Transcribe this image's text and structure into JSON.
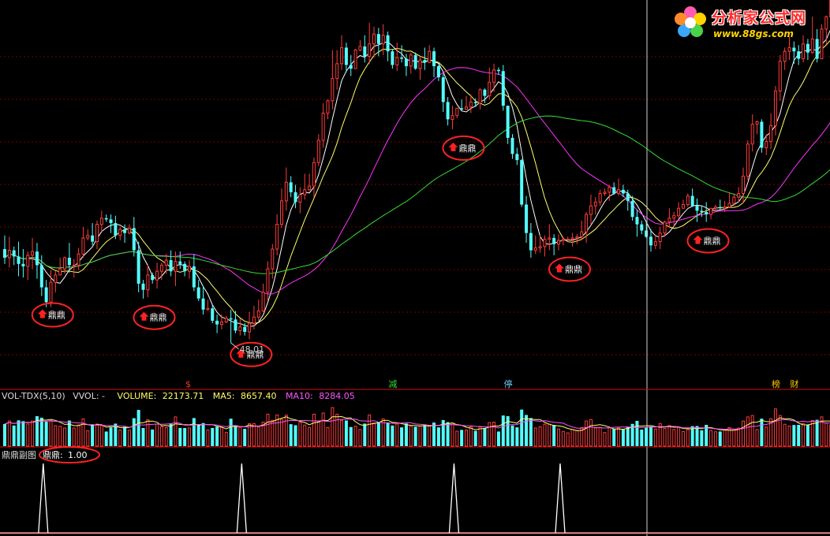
{
  "logo": {
    "title": "分析家公式网",
    "url": "www.88gs.com"
  },
  "colors": {
    "background": "#000000",
    "up": "#ff3b3b",
    "down": "#54ffff",
    "ma_short": "#ffffff",
    "ma_mid": "#ffff66",
    "ma_long": "#ff33ff",
    "ma_longer": "#33dd33",
    "panel_border": "#d01010",
    "highlight_oval": "#ff2222"
  },
  "chart_data": [
    {
      "type": "candlestick",
      "grid": "horizontal dashed",
      "price_range": [
        44.5,
        75.5
      ],
      "low_marker": {
        "label": "48.01",
        "value": 48.01,
        "index": 49
      },
      "event_labels": [
        {
          "index": 40,
          "text": "$"
        },
        {
          "index": 84,
          "text": "减"
        },
        {
          "index": 109,
          "text": "停"
        },
        {
          "index": 167,
          "text": "榜"
        },
        {
          "index": 171,
          "text": "财"
        }
      ],
      "signal_text": "鼎鼎",
      "signals": [
        8,
        30,
        51,
        97,
        120,
        150
      ],
      "candles_o_c_h_l": [
        [
          55.6,
          54.9,
          56.7,
          54.4
        ],
        [
          54.9,
          55.5,
          56.6,
          54.1
        ],
        [
          55.5,
          55.0,
          55.8,
          54.3
        ],
        [
          55.0,
          54.4,
          56.2,
          53.4
        ],
        [
          54.4,
          54.2,
          55.6,
          53.3
        ],
        [
          54.2,
          55.1,
          55.4,
          53.1
        ],
        [
          55.1,
          55.4,
          56.5,
          54.0
        ],
        [
          55.4,
          54.3,
          56.1,
          53.2
        ],
        [
          54.3,
          52.5,
          55.1,
          51.8
        ],
        [
          52.5,
          51.3,
          53.1,
          50.9
        ],
        [
          51.3,
          52.9,
          53.9,
          50.9
        ],
        [
          52.9,
          53.5,
          53.8,
          52.1
        ],
        [
          53.5,
          54.0,
          54.9,
          53.5
        ],
        [
          54.0,
          54.9,
          55.0,
          53.6
        ],
        [
          54.9,
          54.3,
          56.1,
          53.7
        ],
        [
          54.3,
          54.3,
          54.8,
          53.3
        ],
        [
          54.3,
          55.2,
          55.7,
          53.9
        ],
        [
          55.2,
          56.5,
          57.4,
          54.9
        ],
        [
          56.5,
          56.7,
          57.2,
          56.3
        ],
        [
          56.7,
          56.2,
          57.7,
          55.9
        ],
        [
          56.2,
          57.6,
          57.9,
          55.6
        ],
        [
          57.6,
          58.1,
          58.7,
          57.0
        ],
        [
          58.1,
          58.0,
          58.4,
          57.8
        ],
        [
          58.0,
          57.7,
          58.4,
          56.9
        ],
        [
          57.7,
          56.7,
          58.3,
          56.4
        ],
        [
          56.7,
          57.2,
          57.4,
          56.3
        ],
        [
          57.2,
          56.9,
          57.6,
          56.1
        ],
        [
          56.9,
          57.3,
          57.6,
          56.8
        ],
        [
          57.3,
          55.5,
          58.2,
          55.0
        ],
        [
          55.5,
          52.8,
          56.2,
          52.1
        ],
        [
          52.8,
          52.3,
          53.1,
          51.6
        ],
        [
          52.3,
          53.5,
          54.4,
          51.7
        ],
        [
          53.5,
          53.1,
          53.7,
          52.8
        ],
        [
          53.1,
          53.8,
          54.5,
          52.4
        ],
        [
          53.8,
          54.3,
          54.5,
          53.1
        ],
        [
          54.3,
          54.7,
          55.2,
          53.6
        ],
        [
          54.7,
          53.8,
          55.5,
          53.4
        ],
        [
          53.8,
          54.6,
          55.4,
          52.6
        ],
        [
          54.6,
          54.4,
          55.4,
          54.0
        ],
        [
          54.4,
          53.8,
          54.6,
          53.4
        ],
        [
          53.8,
          54.2,
          54.7,
          53.2
        ],
        [
          54.2,
          52.5,
          55.2,
          52.2
        ],
        [
          52.5,
          51.6,
          53.1,
          51.4
        ],
        [
          51.6,
          50.7,
          52.6,
          50.3
        ],
        [
          50.7,
          50.8,
          51.5,
          50.6
        ],
        [
          50.8,
          49.8,
          51.1,
          49.6
        ],
        [
          49.8,
          49.5,
          50.3,
          48.8
        ],
        [
          49.5,
          49.7,
          50.3,
          49.1
        ],
        [
          49.7,
          50.0,
          50.2,
          49.6
        ],
        [
          50.0,
          49.9,
          50.7,
          48.0
        ],
        [
          49.9,
          49.0,
          50.6,
          48.8
        ],
        [
          49.0,
          49.3,
          50.0,
          48.6
        ],
        [
          49.3,
          48.9,
          49.6,
          48.6
        ],
        [
          48.9,
          49.6,
          50.5,
          48.3
        ],
        [
          49.6,
          50.1,
          51.0,
          49.1
        ],
        [
          50.1,
          50.6,
          51.5,
          49.8
        ],
        [
          50.6,
          52.1,
          52.8,
          50.5
        ],
        [
          52.1,
          54.0,
          54.6,
          51.4
        ],
        [
          54.0,
          55.6,
          56.0,
          53.2
        ],
        [
          55.6,
          57.6,
          58.4,
          55.1
        ],
        [
          57.6,
          59.5,
          60.5,
          57.3
        ],
        [
          59.5,
          61.0,
          62.2,
          58.7
        ],
        [
          61.0,
          60.2,
          61.5,
          59.8
        ],
        [
          60.2,
          59.4,
          60.8,
          58.9
        ],
        [
          59.4,
          60.0,
          60.6,
          58.5
        ],
        [
          60.0,
          60.4,
          61.7,
          59.6
        ],
        [
          60.4,
          60.7,
          61.7,
          60.3
        ],
        [
          60.7,
          62.6,
          63.0,
          59.8
        ],
        [
          62.6,
          64.4,
          64.9,
          62.3
        ],
        [
          64.4,
          66.6,
          67.4,
          63.8
        ],
        [
          66.6,
          67.6,
          67.7,
          66.1
        ],
        [
          67.6,
          69.4,
          71.7,
          66.9
        ],
        [
          69.4,
          70.6,
          71.7,
          68.5
        ],
        [
          70.6,
          71.9,
          72.9,
          70.1
        ],
        [
          71.9,
          70.5,
          72.3,
          69.9
        ],
        [
          70.5,
          70.2,
          71.3,
          69.6
        ],
        [
          70.2,
          71.7,
          71.8,
          70.2
        ],
        [
          71.7,
          72.0,
          72.5,
          71.6
        ],
        [
          72.0,
          71.2,
          72.9,
          70.7
        ],
        [
          71.2,
          72.2,
          73.9,
          70.6
        ],
        [
          72.2,
          73.0,
          73.6,
          71.1
        ],
        [
          73.0,
          72.2,
          73.5,
          71.2
        ],
        [
          72.2,
          72.9,
          73.8,
          71.3
        ],
        [
          72.9,
          71.6,
          73.2,
          70.8
        ],
        [
          71.6,
          70.5,
          71.8,
          70.2
        ],
        [
          70.5,
          71.1,
          72.3,
          70.0
        ],
        [
          71.1,
          71.0,
          72.1,
          70.7
        ],
        [
          71.0,
          70.4,
          71.4,
          69.6
        ],
        [
          70.4,
          71.3,
          71.5,
          69.8
        ],
        [
          71.3,
          70.2,
          71.5,
          70.1
        ],
        [
          70.2,
          70.9,
          71.2,
          69.3
        ],
        [
          70.9,
          70.7,
          71.9,
          70.1
        ],
        [
          70.7,
          71.6,
          72.1,
          70.7
        ],
        [
          71.6,
          70.4,
          71.9,
          69.5
        ],
        [
          70.4,
          69.5,
          70.5,
          69.2
        ],
        [
          69.5,
          67.5,
          69.8,
          66.7
        ],
        [
          67.5,
          66.1,
          67.9,
          65.6
        ],
        [
          66.1,
          66.4,
          67.2,
          65.3
        ],
        [
          66.4,
          67.0,
          67.0,
          66.2
        ],
        [
          67.0,
          66.9,
          67.7,
          66.8
        ],
        [
          66.9,
          67.1,
          68.0,
          66.9
        ],
        [
          67.1,
          67.5,
          68.1,
          66.6
        ],
        [
          67.5,
          67.4,
          67.8,
          67.1
        ],
        [
          67.4,
          68.5,
          68.6,
          66.9
        ],
        [
          68.5,
          68.0,
          68.6,
          67.4
        ],
        [
          68.0,
          69.1,
          70.3,
          67.7
        ],
        [
          69.1,
          70.1,
          70.6,
          68.3
        ],
        [
          70.1,
          70.0,
          70.3,
          69.7
        ],
        [
          70.0,
          67.2,
          70.5,
          66.8
        ],
        [
          67.2,
          64.6,
          67.2,
          64.1
        ],
        [
          64.6,
          63.3,
          64.9,
          62.9
        ],
        [
          63.3,
          62.8,
          63.8,
          62.4
        ],
        [
          62.8,
          59.2,
          62.9,
          59.0
        ],
        [
          59.2,
          56.9,
          59.9,
          56.1
        ],
        [
          56.9,
          55.5,
          57.7,
          54.9
        ],
        [
          55.5,
          55.7,
          56.7,
          55.2
        ],
        [
          55.7,
          55.8,
          56.8,
          55.3
        ],
        [
          55.8,
          56.4,
          56.7,
          55.0
        ],
        [
          56.4,
          56.5,
          57.6,
          55.5
        ],
        [
          56.5,
          56.0,
          56.8,
          55.1
        ],
        [
          56.0,
          56.3,
          56.8,
          55.5
        ],
        [
          56.3,
          56.4,
          56.6,
          55.9
        ],
        [
          56.4,
          56.4,
          56.6,
          56.2
        ],
        [
          56.4,
          56.5,
          56.9,
          55.8
        ],
        [
          56.5,
          56.6,
          56.8,
          56.0
        ],
        [
          56.6,
          57.0,
          57.9,
          56.3
        ],
        [
          57.0,
          58.4,
          58.6,
          56.1
        ],
        [
          58.4,
          59.1,
          60.0,
          57.6
        ],
        [
          59.1,
          59.4,
          59.8,
          58.4
        ],
        [
          59.4,
          60.1,
          60.4,
          59.1
        ],
        [
          60.1,
          60.2,
          60.5,
          59.9
        ],
        [
          60.2,
          60.6,
          60.8,
          59.5
        ],
        [
          60.6,
          60.1,
          61.0,
          60.0
        ],
        [
          60.1,
          60.4,
          61.3,
          59.9
        ],
        [
          60.4,
          60.1,
          60.8,
          59.8
        ],
        [
          60.1,
          59.5,
          60.4,
          58.7
        ],
        [
          59.5,
          58.2,
          59.9,
          57.9
        ],
        [
          58.2,
          57.6,
          58.8,
          56.6
        ],
        [
          57.6,
          57.1,
          57.9,
          56.8
        ],
        [
          57.1,
          56.6,
          57.8,
          56.5
        ],
        [
          56.6,
          55.9,
          57.2,
          55.4
        ],
        [
          55.9,
          56.2,
          56.7,
          55.6
        ],
        [
          56.2,
          56.9,
          57.4,
          55.6
        ],
        [
          56.9,
          57.8,
          57.9,
          56.6
        ],
        [
          57.8,
          58.1,
          58.9,
          57.3
        ],
        [
          58.1,
          58.3,
          58.6,
          57.4
        ],
        [
          58.3,
          58.9,
          59.4,
          58.0
        ],
        [
          58.9,
          59.2,
          59.6,
          59.0
        ],
        [
          59.2,
          59.9,
          60.1,
          59.0
        ],
        [
          59.9,
          59.1,
          60.5,
          59.0
        ],
        [
          59.1,
          58.7,
          59.7,
          57.8
        ],
        [
          58.7,
          58.6,
          59.1,
          58.2
        ],
        [
          58.6,
          58.4,
          59.4,
          57.8
        ],
        [
          58.4,
          58.9,
          58.9,
          58.0
        ],
        [
          58.9,
          59.0,
          59.2,
          58.6
        ],
        [
          59.0,
          58.9,
          59.6,
          58.8
        ],
        [
          58.9,
          59.0,
          59.5,
          58.6
        ],
        [
          59.0,
          59.3,
          60.2,
          59.0
        ],
        [
          59.3,
          59.8,
          60.1,
          59.1
        ],
        [
          59.8,
          60.1,
          60.6,
          59.4
        ],
        [
          60.1,
          61.5,
          62.2,
          59.3
        ],
        [
          61.5,
          64.1,
          64.4,
          61.2
        ],
        [
          64.1,
          65.7,
          66.5,
          63.5
        ],
        [
          65.7,
          65.9,
          66.0,
          64.9
        ],
        [
          65.9,
          63.8,
          66.1,
          63.4
        ],
        [
          63.8,
          64.3,
          64.9,
          63.2
        ],
        [
          64.3,
          65.6,
          66.6,
          63.7
        ],
        [
          65.6,
          68.4,
          68.8,
          64.8
        ],
        [
          68.4,
          70.8,
          71.3,
          67.6
        ],
        [
          70.8,
          71.6,
          71.9,
          70.1
        ],
        [
          71.6,
          71.9,
          72.8,
          70.9
        ],
        [
          71.9,
          71.6,
          72.4,
          70.6
        ],
        [
          71.6,
          71.0,
          72.1,
          70.5
        ],
        [
          71.0,
          72.2,
          72.9,
          70.7
        ],
        [
          72.2,
          71.5,
          72.6,
          70.9
        ],
        [
          71.5,
          72.6,
          74.4,
          71.4
        ],
        [
          72.6,
          71.0,
          73.4,
          70.7
        ],
        [
          71.0,
          73.4,
          73.8,
          71.0
        ],
        [
          73.4,
          74.4,
          74.5,
          72.2
        ],
        [
          74.4,
          75.8,
          76.0,
          74.3
        ],
        [
          75.8,
          75.5,
          76.8,
          74.5
        ],
        [
          75.5,
          77.3,
          77.3,
          75.4
        ],
        [
          77.3,
          78.6,
          78.8,
          76.1
        ],
        [
          78.6,
          80.7,
          81.3,
          77.8
        ],
        [
          80.7,
          83.0,
          84.1,
          80.3
        ],
        [
          83.0,
          82.8,
          84.3,
          81.4
        ],
        [
          82.8,
          83.7,
          84.9,
          82.5
        ]
      ],
      "vol_panel": {
        "title": "VOL-TDX(5,10)",
        "mode": "VVOL: -",
        "volume_label": "VOLUME:",
        "volume": "22173.71",
        "ma5_label": "MA5:",
        "ma5": "8657.40",
        "ma10_label": "MA10:",
        "ma10": "8284.05"
      },
      "sub_panel": {
        "title": "鼎鼎副图",
        "value_label": "鼎鼎:",
        "value": "1.00",
        "spikes": [
          8,
          51,
          97,
          120
        ]
      }
    }
  ]
}
